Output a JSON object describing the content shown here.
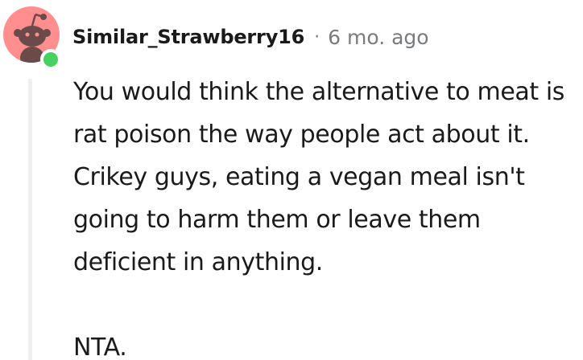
{
  "comment": {
    "username": "Similar_Strawberry16",
    "separator": "·",
    "timestamp": "6 mo. ago",
    "paragraphs": [
      "You would think the alternative to meat is rat poison the way people act about it. Crikey guys, eating a vegan meal isn't going to harm them or leave them deficient in anything.",
      "NTA."
    ],
    "avatar_icon": "snoo-avatar-icon",
    "online_indicator": "online-status-dot",
    "colors": {
      "avatar_background": "#ff8f8f",
      "online": "#46d160",
      "meta_text": "#787c7e",
      "body_text": "#1a1a1b",
      "thread_line": "#edeff1"
    }
  }
}
